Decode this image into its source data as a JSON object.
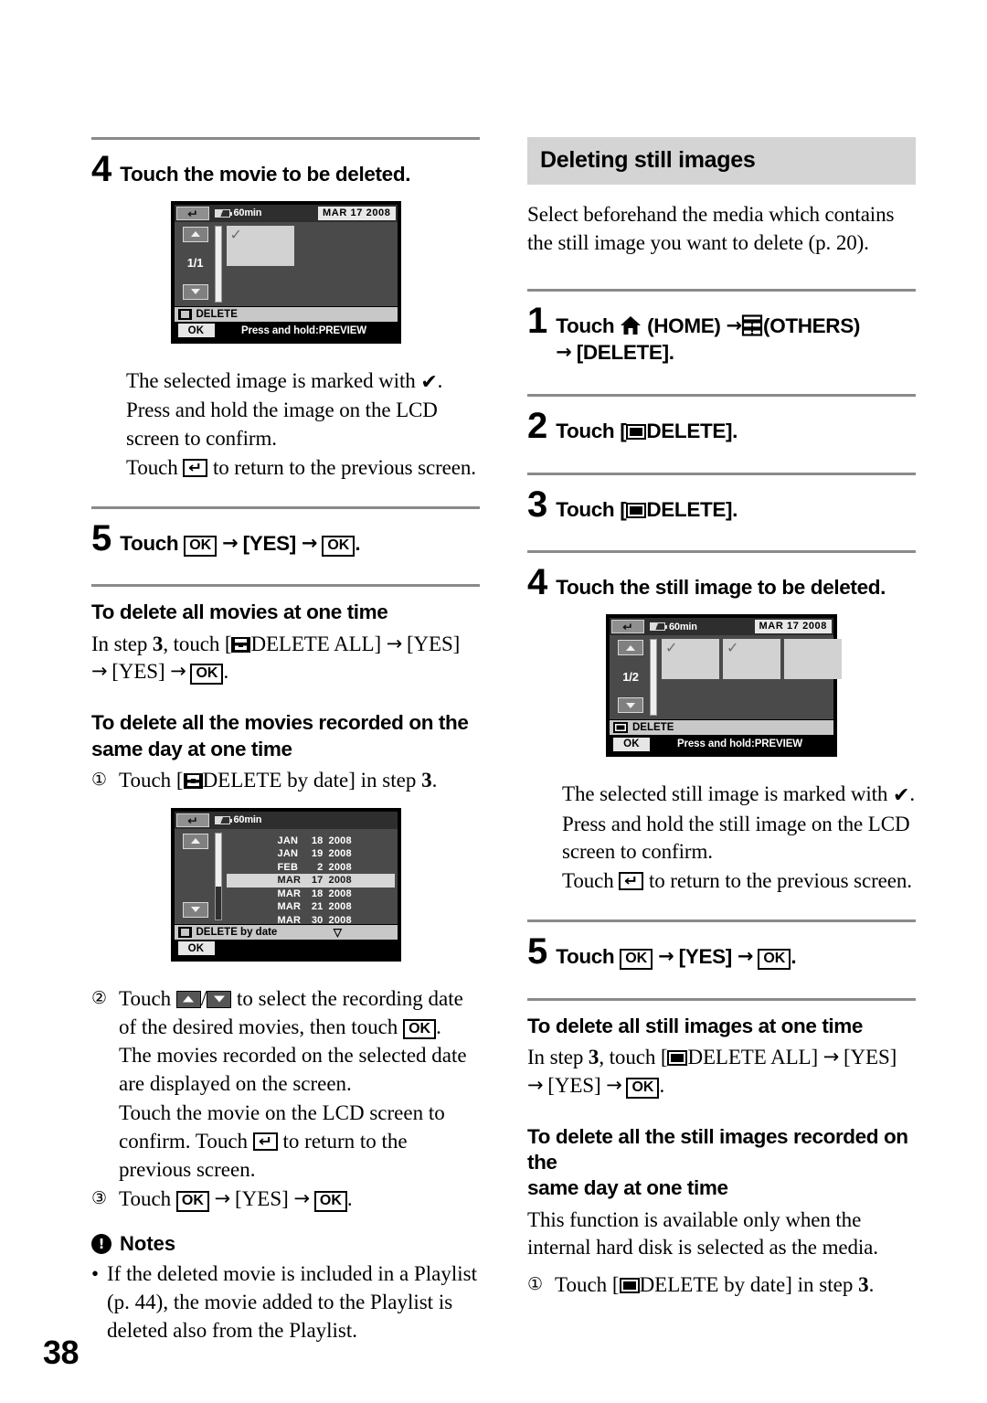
{
  "page_number": "38",
  "left_column": {
    "step4": {
      "num": "4",
      "text": "Touch the movie to be deleted."
    },
    "lcd_movie": {
      "return_icon": "return-arrow-icon",
      "battery_icon": "battery-icon",
      "battery_text": "60min",
      "date_badge": "MAR 17 2008",
      "page_indicator": "1/1",
      "up_icon": "arrow-up-icon",
      "down_icon": "arrow-down-icon",
      "thumbnails": [
        {
          "checked": true
        }
      ],
      "action_icon": "film-strip-icon",
      "action_label": "DELETE",
      "ok_label": "OK",
      "hint": "Press and hold:PREVIEW"
    },
    "after_step4": {
      "line1_a": "The selected image is marked with ",
      "line1_check": "✔",
      "line1_b": ".",
      "line2": "Press and hold the image on the LCD screen to confirm.",
      "line3_a": "Touch ",
      "line3_icon": "return-arrow-icon",
      "line3_b": " to return to the previous screen."
    },
    "step5": {
      "num": "5",
      "touch_label": "Touch",
      "ok1": "OK",
      "arrow": "→",
      "yes": "[YES]",
      "ok2": "OK",
      "period": "."
    },
    "sub1": {
      "heading": "To delete all movies at one time",
      "body_a": "In step ",
      "body_step": "3",
      "body_b": ", touch [",
      "body_icon": "film-strip-icon",
      "body_c": "DELETE ALL] ",
      "arrow": "→",
      "yes1": "[YES]",
      "yes2": "[YES]",
      "ok": "OK",
      "period": "."
    },
    "sub2": {
      "heading_line1": "To delete all the movies recorded on the",
      "heading_line2": "same day at one time",
      "item1": {
        "marker": "①",
        "a": "Touch [",
        "icon": "film-strip-icon",
        "b": "DELETE by date] in step ",
        "step": "3",
        "c": "."
      },
      "item2": {
        "marker": "②",
        "a": "Touch ",
        "up_icon": "arrow-up-icon",
        "slash": "/",
        "down_icon": "arrow-down-icon",
        "b": " to select the recording date of the desired movies, then touch ",
        "ok": "OK",
        "c": ".",
        "p1": "The movies recorded on the selected date are displayed on the screen.",
        "p2_a": "Touch the movie on the LCD screen to confirm. Touch ",
        "p2_icon": "return-arrow-icon",
        "p2_b": " to return to the previous screen."
      },
      "item3": {
        "marker": "③",
        "a": "Touch ",
        "ok1": "OK",
        "arrow": "→",
        "yes": "[YES]",
        "ok2": "OK",
        "b": "."
      }
    },
    "lcd_date": {
      "return_icon": "return-arrow-icon",
      "battery_icon": "battery-icon",
      "battery_text": "60min",
      "up_icon": "arrow-up-icon",
      "down_icon": "arrow-down-icon",
      "dates": [
        {
          "month": "JAN",
          "day": "18",
          "year": "2008",
          "selected": false
        },
        {
          "month": "JAN",
          "day": "19",
          "year": "2008",
          "selected": false
        },
        {
          "month": "FEB",
          "day": "2",
          "year": "2008",
          "selected": false
        },
        {
          "month": "MAR",
          "day": "17",
          "year": "2008",
          "selected": true
        },
        {
          "month": "MAR",
          "day": "18",
          "year": "2008",
          "selected": false
        },
        {
          "month": "MAR",
          "day": "21",
          "year": "2008",
          "selected": false
        },
        {
          "month": "MAR",
          "day": "30",
          "year": "2008",
          "selected": false
        }
      ],
      "caret": "▽",
      "action_icon": "film-strip-icon",
      "action_label": "DELETE by date",
      "ok_label": "OK"
    },
    "notes": {
      "icon": "notes-warning-icon",
      "heading": "Notes",
      "bullet": "•",
      "text": "If the deleted movie is included in a Playlist (p. 44), the movie added to the Playlist is deleted also from the Playlist."
    }
  },
  "right_column": {
    "section_heading": "Deleting still images",
    "intro": "Select beforehand the media which contains the still image you want to delete (p. 20).",
    "step1": {
      "num": "1",
      "a": "Touch ",
      "home_icon": "home-icon",
      "b": " (HOME) ",
      "arrow": "→",
      "others_icon": "others-drawer-icon",
      "c": "(OTHERS)",
      "d": "[DELETE]."
    },
    "step2": {
      "num": "2",
      "a": "Touch [",
      "icon": "still-image-icon",
      "b": "DELETE]."
    },
    "step3": {
      "num": "3",
      "a": "Touch [",
      "icon": "still-image-icon",
      "b": "DELETE]."
    },
    "step4": {
      "num": "4",
      "text": "Touch the still image to be deleted."
    },
    "lcd_still": {
      "return_icon": "return-arrow-icon",
      "battery_icon": "battery-icon",
      "battery_text": "60min",
      "date_badge": "MAR 17 2008",
      "page_indicator": "1/2",
      "up_icon": "arrow-up-icon",
      "down_icon": "arrow-down-icon",
      "thumbnails": [
        {
          "checked": true
        },
        {
          "checked": true
        },
        {
          "checked": false
        }
      ],
      "action_icon": "still-image-icon",
      "action_label": "DELETE",
      "ok_label": "OK",
      "hint": "Press and hold:PREVIEW"
    },
    "after_step4": {
      "line1_a": "The selected still image is marked with ",
      "line1_check": "✔",
      "line1_b": ".",
      "line2": "Press and hold the still image on the LCD screen to confirm.",
      "line3_a": "Touch ",
      "line3_icon": "return-arrow-icon",
      "line3_b": " to return to the previous screen."
    },
    "step5": {
      "num": "5",
      "touch_label": "Touch",
      "ok1": "OK",
      "arrow": "→",
      "yes": "[YES]",
      "ok2": "OK",
      "period": "."
    },
    "sub1": {
      "heading": "To delete all still images at one time",
      "body_a": "In step ",
      "body_step": "3",
      "body_b": ", touch [",
      "body_icon": "still-image-icon",
      "body_c": "DELETE ALL] ",
      "arrow": "→",
      "yes1": "[YES]",
      "yes2": "[YES]",
      "ok": "OK",
      "period": "."
    },
    "sub2": {
      "heading_line1": "To delete all the still images recorded on the",
      "heading_line2": "same day at one time",
      "body": "This function is available only when the internal hard disk is selected as the media.",
      "item1": {
        "marker": "①",
        "a": "Touch [",
        "icon": "still-image-icon",
        "b": "DELETE by date] in step ",
        "step": "3",
        "c": "."
      }
    }
  }
}
